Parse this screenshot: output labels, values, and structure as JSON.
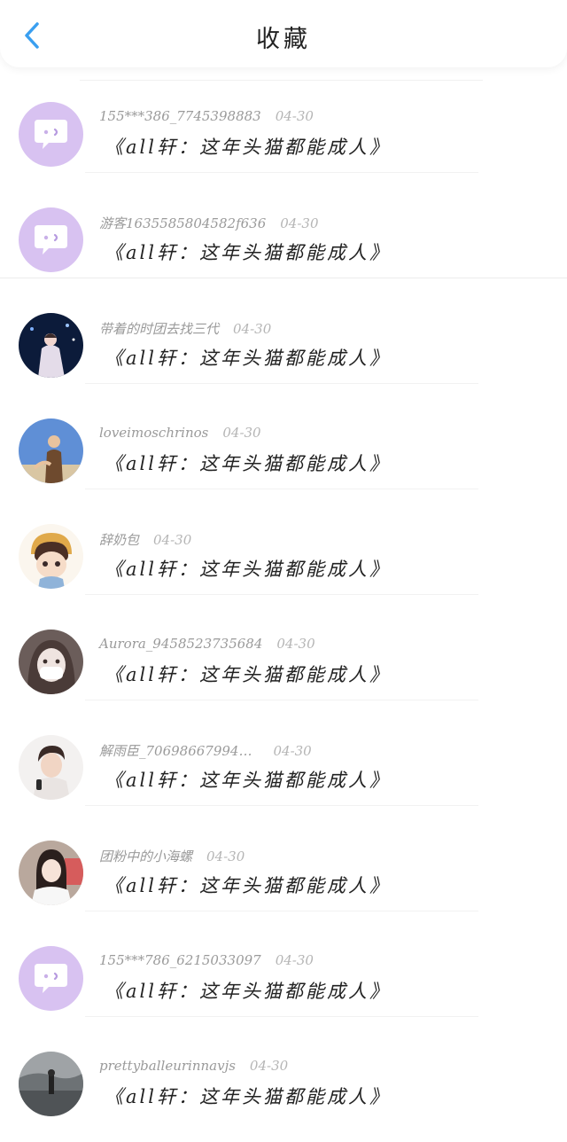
{
  "header": {
    "title": "收藏"
  },
  "colors": {
    "accent_blue": "#3a9ff0",
    "default_avatar_bg": "#d8c2f1"
  },
  "items": [
    {
      "user": "155***386_7745398883",
      "date": "04-30",
      "title": "《all轩：这年头猫都能成人》",
      "avatar": "default-chat-bubble"
    },
    {
      "user": "游客1635585804582f636",
      "date": "04-30",
      "title": "《all轩：这年头猫都能成人》",
      "avatar": "default-chat-bubble"
    },
    {
      "user": "带着的时团去找三代",
      "date": "04-30",
      "title": "《all轩：这年头猫都能成人》",
      "avatar": "photo-stage"
    },
    {
      "user": "loveimoschrinos",
      "date": "04-30",
      "title": "《all轩：这年头猫都能成人》",
      "avatar": "photo-sky"
    },
    {
      "user": "辞奶包",
      "date": "04-30",
      "title": "《all轩：这年头猫都能成人》",
      "avatar": "cartoon-boy"
    },
    {
      "user": "Aurora_9458523735684",
      "date": "04-30",
      "title": "《all轩：这年头猫都能成人》",
      "avatar": "anime-mask"
    },
    {
      "user": "解雨臣_70698667994…",
      "date": "04-30",
      "title": "《all轩：这年头猫都能成人》",
      "avatar": "portrait-man"
    },
    {
      "user": "团粉中的小海螺",
      "date": "04-30",
      "title": "《all轩：这年头猫都能成人》",
      "avatar": "portrait-girl"
    },
    {
      "user": "155***786_6215033097",
      "date": "04-30",
      "title": "《all轩：这年头猫都能成人》",
      "avatar": "default-chat-bubble"
    },
    {
      "user": "prettyballeurinnavjs",
      "date": "04-30",
      "title": "《all轩：这年头猫都能成人》",
      "avatar": "photo-street"
    }
  ]
}
